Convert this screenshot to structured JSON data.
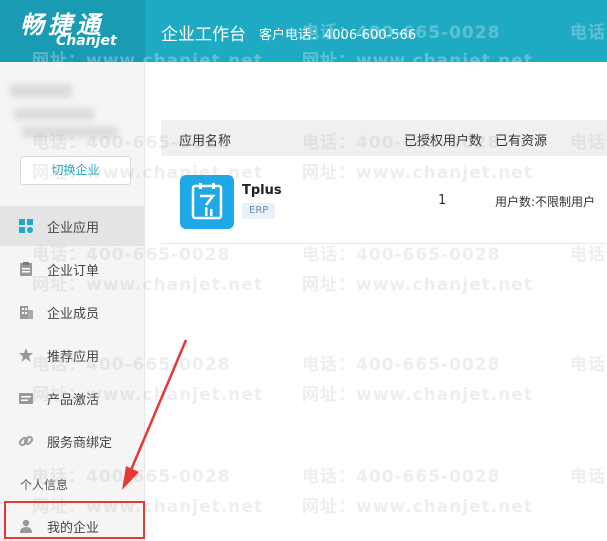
{
  "header": {
    "logo_cn": "畅捷通",
    "logo_en": "Chanjet",
    "title": "企业工作台",
    "phone": "客户电话：4006-600-566"
  },
  "sidebar": {
    "switch_label": "切换企业",
    "items": [
      {
        "label": "企业应用",
        "icon": "grid-icon"
      },
      {
        "label": "企业订单",
        "icon": "clipboard-icon"
      },
      {
        "label": "企业成员",
        "icon": "building-icon"
      },
      {
        "label": "推荐应用",
        "icon": "star-icon"
      },
      {
        "label": "产品激活",
        "icon": "card-icon"
      },
      {
        "label": "服务商绑定",
        "icon": "link-icon"
      }
    ],
    "section_label": "个人信息",
    "my_company": "我的企业"
  },
  "table": {
    "headers": [
      "应用名称",
      "已授权用户数",
      "已有资源"
    ],
    "rows": [
      {
        "name": "Tplus",
        "badge": "ERP",
        "count": "1",
        "resource": "用户数:不限制用户"
      }
    ]
  },
  "watermark": {
    "phone": "电话：400-665-0028",
    "site": "网址：www.chanjet.net"
  },
  "colors": {
    "brand": "#1faac4",
    "highlight": "#e53935"
  }
}
